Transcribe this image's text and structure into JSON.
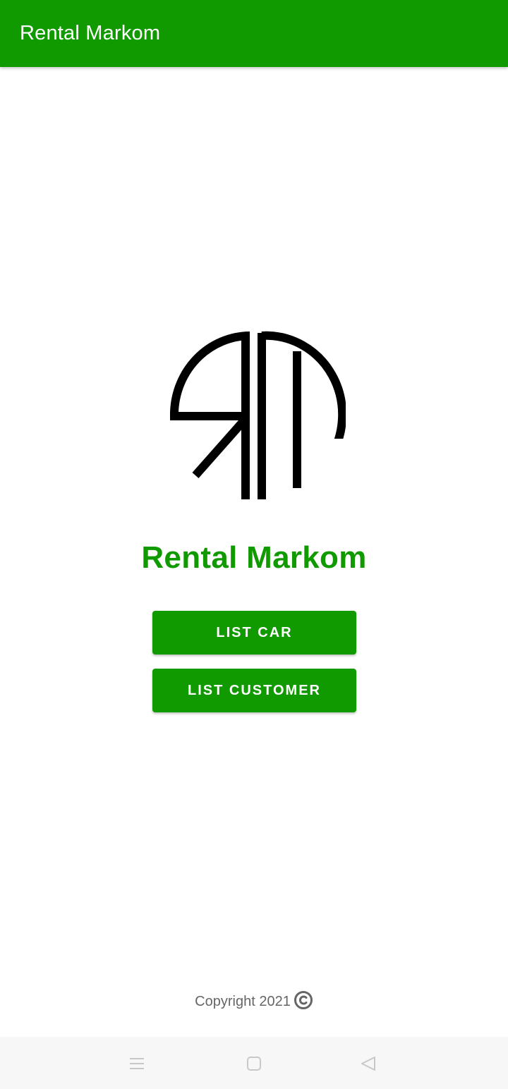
{
  "app_bar": {
    "title": "Rental Markom"
  },
  "logo": {
    "icon": "rm-monogram-logo",
    "color": "#000000"
  },
  "main": {
    "brand_title": "Rental Markom",
    "buttons": {
      "list_car": "LIST CAR",
      "list_customer": "LIST CUSTOMER"
    }
  },
  "footer": {
    "copyright_text": "Copyright 2021",
    "copyright_icon": "copyright-icon"
  },
  "nav_bar": {
    "items": [
      "menu-icon",
      "home-square-icon",
      "back-triangle-icon"
    ]
  },
  "colors": {
    "primary": "#119a00",
    "on_primary": "#ffffff",
    "footer_text": "#666666",
    "nav_bar_bg": "#f7f7f7",
    "nav_icon": "#c8c8c8"
  }
}
